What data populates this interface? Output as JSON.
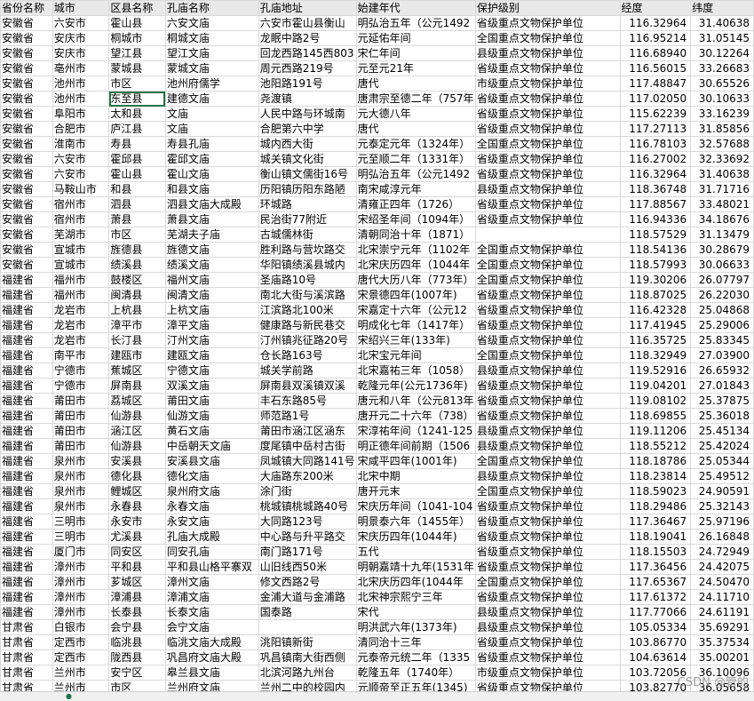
{
  "headers": [
    "省份名称",
    "城市",
    "区县名称",
    "孔庙名称",
    "孔庙地址",
    "始建年代",
    "保护级别",
    "经度",
    "纬度"
  ],
  "rows": [
    [
      "安徽省",
      "六安市",
      "霍山县",
      "六安文庙",
      "六安市霍山县衡山",
      "明弘治五年（公元1492",
      "省级重点文物保护单位",
      "116.32964",
      "31.40638"
    ],
    [
      "安徽省",
      "安庆市",
      "桐城市",
      "桐城文庙",
      "龙眠中路2号",
      "元延佑年间",
      "全国重点文物保护单位",
      "116.95214",
      "31.05145"
    ],
    [
      "安徽省",
      "安庆市",
      "望江县",
      "望江文庙",
      "回龙西路145西803",
      "宋仁年间",
      "县级重点文物保护单位",
      "116.68940",
      "30.12264"
    ],
    [
      "安徽省",
      "亳州市",
      "蒙城县",
      "蒙城文庙",
      "周元西路219号",
      "元至元21年",
      "省级重点文物保护单位",
      "116.56015",
      "33.26683"
    ],
    [
      "安徽省",
      "池州市",
      "市区",
      "池州府儒学",
      "池阳路191号",
      "唐代",
      "市级重点文物保护单位",
      "117.48847",
      "30.65526"
    ],
    [
      "安徽省",
      "池州市",
      "东至县",
      "建德文庙",
      "尧渡镇",
      "唐肃宗至德二年（757年",
      "省级重点文物保护单位",
      "117.02050",
      "30.10633"
    ],
    [
      "安徽省",
      "阜阳市",
      "太和县",
      "文庙",
      "人民中路与环城南",
      "元大德八年",
      "省级重点文物保护单位",
      "115.62239",
      "33.16239"
    ],
    [
      "安徽省",
      "合肥市",
      "庐江县",
      "文庙",
      "合肥第六中学",
      "唐代",
      "省级重点文物保护单位",
      "117.27113",
      "31.85856"
    ],
    [
      "安徽省",
      "淮南市",
      "寿县",
      "寿县孔庙",
      "城内西大街",
      "元泰定元年（1324年）",
      "全国重点文物保护单位",
      "116.78103",
      "32.57688"
    ],
    [
      "安徽省",
      "六安市",
      "霍邱县",
      "霍邱文庙",
      "城关镇文化街",
      "元至顺二年（1331年）",
      "省级重点文物保护单位",
      "116.27002",
      "32.33692"
    ],
    [
      "安徽省",
      "六安市",
      "霍山县",
      "霍山文庙",
      "衡山镇文儒街16号",
      "明弘治五年（公元1492",
      "省级重点文物保护单位",
      "116.32964",
      "31.40638"
    ],
    [
      "安徽省",
      "马鞍山市",
      "和县",
      "和县文庙",
      "历阳镇历阳东路陋",
      "南宋咸淳元年",
      "县级重点文物保护单位",
      "118.36748",
      "31.71716"
    ],
    [
      "安徽省",
      "宿州市",
      "泗县",
      "泗县文庙大成殿",
      "环城路",
      "清雍正四年（1726）",
      "省级重点文物保护单位",
      "117.88567",
      "33.48021"
    ],
    [
      "安徽省",
      "宿州市",
      "萧县",
      "萧县文庙",
      "民治街77附近",
      "宋绍圣年间（1094年）",
      "省级重点文物保护单位",
      "116.94336",
      "34.18676"
    ],
    [
      "安徽省",
      "芜湖市",
      "市区",
      "芜湖夫子庙",
      "古城儒林街",
      "清朝同治十年（1871）",
      "",
      "118.57529",
      "31.13479"
    ],
    [
      "安徽省",
      "宣城市",
      "旌德县",
      "旌德文庙",
      "胜利路与营坎路交",
      "北宋崇宁元年（1102年",
      "全国重点文物保护单位",
      "118.54136",
      "30.28679"
    ],
    [
      "安徽省",
      "宣城市",
      "绩溪县",
      "绩溪文庙",
      "华阳镇绩溪县城内",
      "北宋庆历四年（1044年",
      "全国重点文物保护单位",
      "118.57993",
      "30.06633"
    ],
    [
      "福建省",
      "福州市",
      "鼓楼区",
      "福州文庙",
      "圣庙路10号",
      "唐代大历八年（773年）",
      "全国重点文物保护单位",
      "119.30206",
      "26.07797"
    ],
    [
      "福建省",
      "福州市",
      "闽清县",
      "闽清文庙",
      "南北大街与溪滨路",
      "宋景德四年(1007年)",
      "省级重点文物保护单位",
      "118.87025",
      "26.22030"
    ],
    [
      "福建省",
      "龙岩市",
      "上杭县",
      "上杭文庙",
      "江滨路北100米",
      "宋嘉定十六年（公元12",
      "省级重点文物保护单位",
      "116.42328",
      "25.04868"
    ],
    [
      "福建省",
      "龙岩市",
      "漳平市",
      "漳平文庙",
      "健康路与新民巷交",
      "明成化七年（1417年）",
      "省级重点文物保护单位",
      "117.41945",
      "25.29006"
    ],
    [
      "福建省",
      "龙岩市",
      "长汀县",
      "汀州文庙",
      "汀州镇兆征路20号",
      "宋绍兴三年(133年)",
      "省级重点文物保护单位",
      "116.35725",
      "25.83345"
    ],
    [
      "福建省",
      "南平市",
      "建瓯市",
      "建瓯文庙",
      "仓长路163号",
      "北宋宝元年间",
      "全国重点文物保护单位",
      "118.32949",
      "27.03900"
    ],
    [
      "福建省",
      "宁德市",
      "蕉城区",
      "宁德文庙",
      "城关学前路",
      "北宋嘉祐三年（1058）",
      "县级重点文物保护单位",
      "119.52916",
      "26.65932"
    ],
    [
      "福建省",
      "宁德市",
      "屏南县",
      "双溪文庙",
      "屏南县双溪镇双溪",
      "乾隆元年(公元1736年)",
      "省级重点文物保护单位",
      "119.04201",
      "27.01843"
    ],
    [
      "福建省",
      "莆田市",
      "荔城区",
      "莆田文庙",
      "丰石东路85号",
      "唐元和八年（公元813年",
      "省级重点文物保护单位",
      "119.08102",
      "25.37875"
    ],
    [
      "福建省",
      "莆田市",
      "仙游县",
      "仙游文庙",
      "师范路1号",
      "唐开元二十六年（738）",
      "省级重点文物保护单位",
      "118.69855",
      "25.36018"
    ],
    [
      "福建省",
      "莆田市",
      "涵江区",
      "黄石文庙",
      "莆田市涵江区涵东",
      "宋淳祐年间（1241-125",
      "县级重点文物保护单位",
      "119.11206",
      "25.45134"
    ],
    [
      "福建省",
      "莆田市",
      "仙游县",
      "中岳朝天文庙",
      "度尾镇中岳村古街",
      "明正德年间前期（1506",
      "县级重点文物保护单位",
      "118.55212",
      "25.42024"
    ],
    [
      "福建省",
      "泉州市",
      "安溪县",
      "安溪县文庙",
      "凤城镇大同路141号",
      "宋咸平四年(1001年)",
      "全国重点文物保护单位",
      "118.18786",
      "25.05344"
    ],
    [
      "福建省",
      "泉州市",
      "德化县",
      "德化文庙",
      "大庙路东200米",
      "北宋中期",
      "县级重点文物保护单位",
      "118.23814",
      "25.49512"
    ],
    [
      "福建省",
      "泉州市",
      "鲤城区",
      "泉州府文庙",
      "涂门街",
      "唐开元末",
      "全国重点文物保护单位",
      "118.59023",
      "24.90591"
    ],
    [
      "福建省",
      "泉州市",
      "永春县",
      "永春文庙",
      "桃城镇桃城路40号",
      "宋庆历年间（1041-104",
      "省级重点文物保护单位",
      "118.29486",
      "25.32143"
    ],
    [
      "福建省",
      "三明市",
      "永安市",
      "永安文庙",
      "大同路123号",
      "明景泰六年（1455年）",
      "省级重点文物保护单位",
      "117.36467",
      "25.97196"
    ],
    [
      "福建省",
      "三明市",
      "尤溪县",
      "孔庙大成殿",
      "中心路与升平路交",
      "宋庆历四年(1044年)",
      "省级重点文物保护单位",
      "118.19041",
      "26.16848"
    ],
    [
      "福建省",
      "厦门市",
      "同安区",
      "同安孔庙",
      "南门路171号",
      "五代",
      "省级重点文物保护单位",
      "118.15503",
      "24.72949"
    ],
    [
      "福建省",
      "漳州市",
      "平和县",
      "平和县山格平寨双",
      "山旧线西50米",
      "明朝嘉靖十九年(1531年",
      "省级重点文物保护单位",
      "117.36456",
      "24.42075"
    ],
    [
      "福建省",
      "漳州市",
      "芗城区",
      "漳州文庙",
      "修文西路2号",
      "北宋庆历四年(1044年",
      "全国重点文物保护单位",
      "117.65367",
      "24.50470"
    ],
    [
      "福建省",
      "漳州市",
      "漳浦县",
      "漳浦文庙",
      "金浦大道与金浦路",
      "北宋神宗熙宁三年",
      "省级重点文物保护单位",
      "117.61372",
      "24.11710"
    ],
    [
      "福建省",
      "漳州市",
      "长泰县",
      "长泰文庙",
      "国泰路",
      "宋代",
      "县级重点文物保护单位",
      "117.77066",
      "24.61191"
    ],
    [
      "甘肃省",
      "白银市",
      "会宁县",
      "会宁文庙",
      "",
      "明洪武六年(1373年)",
      "县级重点文物保护单位",
      "105.05334",
      "35.69291"
    ],
    [
      "甘肃省",
      "定西市",
      "临洮县",
      "临洮文庙大成殿",
      "洮阳镇新街",
      "清同治十三年",
      "省级重点文物保护单位",
      "103.86770",
      "35.37534"
    ],
    [
      "甘肃省",
      "定西市",
      "陇西县",
      "巩昌府文庙大殿",
      "巩昌镇南大街西侧",
      "元泰帝元统二年（1335",
      "省级重点文物保护单位",
      "104.63614",
      "35.00201"
    ],
    [
      "甘肃省",
      "兰州市",
      "安宁区",
      "皋兰县文庙",
      "北滨河路九州台",
      "乾隆五年（1740年）",
      "市级重点文物保护单位",
      "103.72056",
      "36.10096"
    ],
    [
      "甘肃省",
      "兰州市",
      "市区",
      "兰州府文庙",
      "兰州二中的校园内",
      "元顺帝至正五年(1345)",
      "省级重点文物保护单位",
      "103.82770",
      "36.05658"
    ]
  ],
  "selected_cell": {
    "row": 5,
    "col": 2
  },
  "watermark": "CSDN @管的"
}
